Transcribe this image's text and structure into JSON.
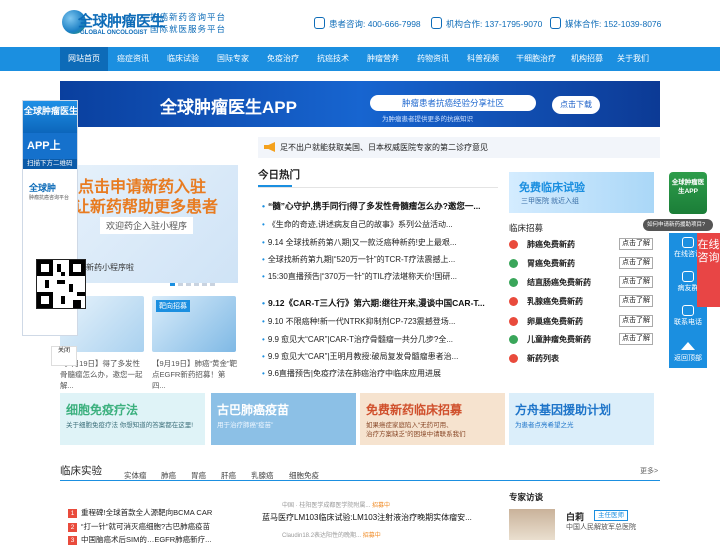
{
  "header": {
    "logo_cn": "全球肿瘤医生",
    "logo_en": "GLOBAL ONCOLOGIST",
    "slogan_line1": "抗癌新药咨询平台",
    "slogan_line2": "国际就医服务平台",
    "contacts": [
      {
        "label": "患者咨询: 400-666-7998",
        "icon": "phone-icon"
      },
      {
        "label": "机构合作: 137-1795-9070",
        "icon": "building-icon"
      },
      {
        "label": "媒体合作: 152-1039-8076",
        "icon": "media-icon"
      }
    ]
  },
  "nav": {
    "items": [
      "网站首页",
      "癌症资讯",
      "临床试验",
      "国际专家",
      "免疫治疗",
      "抗癌技术",
      "肿瘤营养",
      "药物资讯",
      "科普视频",
      "干细胞治疗",
      "机构招募",
      "关于我们"
    ],
    "active_index": 0
  },
  "banner": {
    "title": "全球肿瘤医生APP",
    "subtitle": "肿瘤患者抗癌经验分享社区",
    "subtitle2": "为肿瘤患者提供更多的抗癌知识",
    "button": "点击下载"
  },
  "notice": {
    "text": "足不出户就能获取美国、日本权威医院专家的第二诊疗意见"
  },
  "ad_big": {
    "line1": "点击申请新药入驻",
    "line2": "让新药帮助更多患者",
    "line3": "欢迎药企入驻小程序",
    "caption": "新药小程序啦"
  },
  "thumbs": [
    {
      "caption": "【9月19日】得了多发性骨髓瘤怎么办，邀您一起解..."
    },
    {
      "caption": "【9月19日】肺癌“黄金”靶点EGFR新药招募！第四..."
    }
  ],
  "thumb2_badge": "靶向招募",
  "hot": {
    "title": "今日热门",
    "items": [
      {
        "text": "“髓”心守护,携手同行|得了多发性骨髓瘤怎么办?邀您一...",
        "lead": true
      },
      {
        "text": "《生命的奇迹,讲述病友自己的故事》系列公益活动...",
        "lead": false
      },
      {
        "text": "9.14 全球找新药第八期|又一款泛癌种新药!史上最艰...",
        "lead": false
      },
      {
        "text": "全球找新药第九期|“520万一针”的TCR-T疗法震撼上...",
        "lead": false
      },
      {
        "text": "15:30直播预告|“370万一针”的TIL疗法堪称天价!国研...",
        "lead": false
      },
      {
        "text": "9.12《CAR-T三人行》第六期:继往开来,漫谈中国CAR-T...",
        "lead": true
      },
      {
        "text": "9.10 不限癌种!新一代NTRK抑制剂CP-723震撼登场...",
        "lead": false
      },
      {
        "text": "9.9 愈见大“CAR”|CAR-T治疗骨髓瘤一共分几步?全...",
        "lead": false
      },
      {
        "text": "9.9 愈见大“CAR”|王明月教授:破局复发骨髓瘤患者治...",
        "lead": false
      },
      {
        "text": "9.6直播预告|免疫疗法在肺癌治疗中临床应用进展",
        "lead": false
      }
    ]
  },
  "trial_ad": {
    "title": "免费临床试验",
    "sub": "三甲医院  就近入组"
  },
  "trial": {
    "heading": "临床招募",
    "button": "点击了解",
    "items": [
      "肺癌免费新药",
      "胃癌免费新药",
      "结直肠癌免费新药",
      "乳腺癌免费新药",
      "卵巢癌免费新药",
      "儿童肿瘤免费新药",
      "新药列表"
    ]
  },
  "promos": [
    {
      "title": "细胞免疫疗法",
      "sub": "关于细胞免疫疗法\n你想知道的答案都在这里!",
      "bg": "#dff3f7",
      "color": "#3bb07e"
    },
    {
      "title": "古巴肺癌疫苗",
      "sub": "用于治疗肺癌“疫苗”",
      "bg": "#8cc0e6",
      "color": "#ffffff"
    },
    {
      "title": "免费新药临床招募",
      "sub": "如果癌症家庭陷入“无药可用、\n治疗方案缺乏”的困境中请联系我们",
      "bg": "#f6e3cf",
      "color": "#d0502c"
    },
    {
      "title": "方舟基因援助计划",
      "sub": "为患者点亮希望之光",
      "bg": "#dbeefa",
      "color": "#1d74c9"
    }
  ],
  "clinical": {
    "title": "临床实验",
    "tabs": [
      "实体瘤",
      "肺癌",
      "胃癌",
      "肝癌",
      "乳腺癌",
      "细胞免疫"
    ],
    "more": "更多>",
    "left_items": [
      "重程碑!全球首款全人源靶向BCMA CAR",
      "“打一针”就可消灭癌细胞?古巴肺癌疫苗",
      "中国脑癌术后SIM的…EGFR肺癌新疗..."
    ],
    "ctx_small1": "中国 · 桂阳医学成都医学院附属...",
    "ctx_tag": "招募中",
    "ctx_title": "蓝马医疗LM103临床试验:LM103注射液治疗晚期实体瘤安...",
    "ctx_small2": "Claudin18.2表达阳性的晚期..."
  },
  "expert": {
    "title": "专家访谈",
    "name": "白莉",
    "tag": "主任医师",
    "hospital": "中国人民解放军总医院"
  },
  "float_left": {
    "head": "全球肿瘤医生",
    "app": "APP上",
    "scan": "扫描下方二维码",
    "logo": "全球肿",
    "logo2": "肿瘤抗癌咨询平台",
    "close": "关闭"
  },
  "float_right": {
    "app": "全球肿瘤医生APP",
    "tip": "如何申请新药援助项目?",
    "online": "在线咨询",
    "items": [
      "在线咨询",
      "病友群",
      "联系电话"
    ],
    "top": "返回顶部"
  }
}
